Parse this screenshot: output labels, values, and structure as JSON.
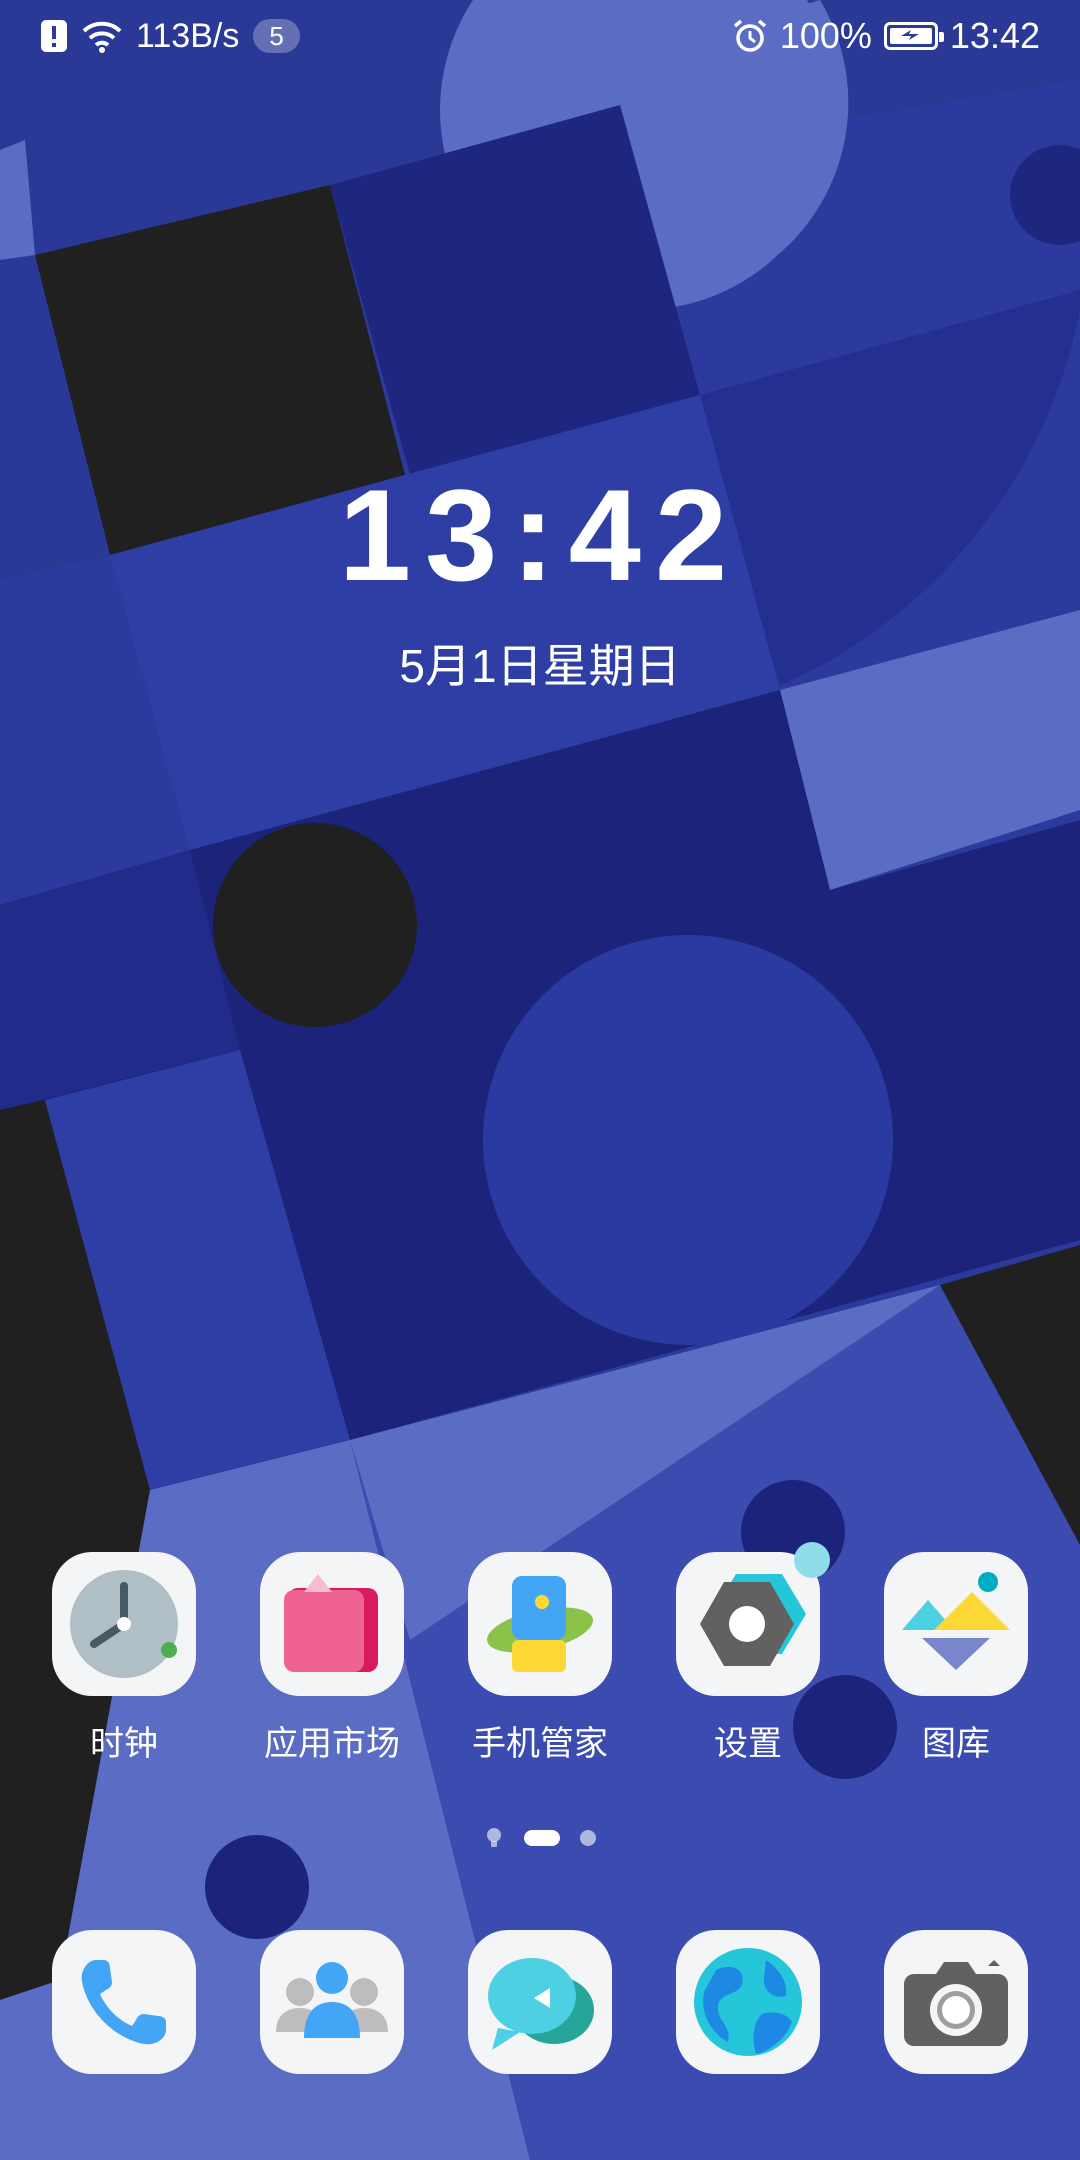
{
  "status_bar": {
    "net_speed": "113B/s",
    "notification_count": "5",
    "battery": "100%",
    "time": "13:42"
  },
  "clock_widget": {
    "time": "13:42",
    "date": "5月1日星期日"
  },
  "apps": [
    {
      "label": "时钟",
      "icon": "clock-icon"
    },
    {
      "label": "应用市场",
      "icon": "app-market-icon"
    },
    {
      "label": "手机管家",
      "icon": "phone-manager-icon"
    },
    {
      "label": "设置",
      "icon": "settings-icon"
    },
    {
      "label": "图库",
      "icon": "gallery-icon"
    }
  ],
  "page_indicator": {
    "pages": 2,
    "current": 1
  },
  "dock": [
    {
      "icon": "phone-icon"
    },
    {
      "icon": "contacts-icon"
    },
    {
      "icon": "messages-icon"
    },
    {
      "icon": "browser-icon"
    },
    {
      "icon": "camera-icon"
    }
  ],
  "colors": {
    "wallpaper_base": "#2b3a9c",
    "wallpaper_dark": "#1b237a",
    "wallpaper_light": "#5b6cc4",
    "wallpaper_black": "#202020",
    "tile_bg": "#f4f5f7"
  }
}
